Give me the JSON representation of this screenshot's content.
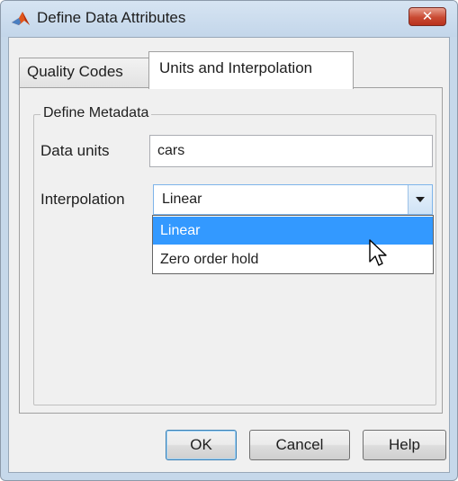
{
  "window": {
    "title": "Define Data Attributes",
    "close_label": "✕"
  },
  "tabs": [
    {
      "label": "Quality Codes",
      "active": false
    },
    {
      "label": "Units and Interpolation",
      "active": true
    }
  ],
  "metadata": {
    "group_label": "Define Metadata",
    "data_units_label": "Data units",
    "data_units_value": "cars",
    "interpolation_label": "Interpolation",
    "interpolation_value": "Linear",
    "interpolation_options": [
      "Linear",
      "Zero order hold"
    ],
    "highlighted_option": "Linear"
  },
  "buttons": {
    "ok": "OK",
    "cancel": "Cancel",
    "help": "Help"
  },
  "colors": {
    "selection": "#3399ff",
    "close_button": "#c94a33",
    "matlab_icon": "#e0561c"
  },
  "icons": {
    "app": "matlab-logo-icon",
    "dropdown": "chevron-down-icon",
    "pointer": "mouse-pointer-icon"
  }
}
